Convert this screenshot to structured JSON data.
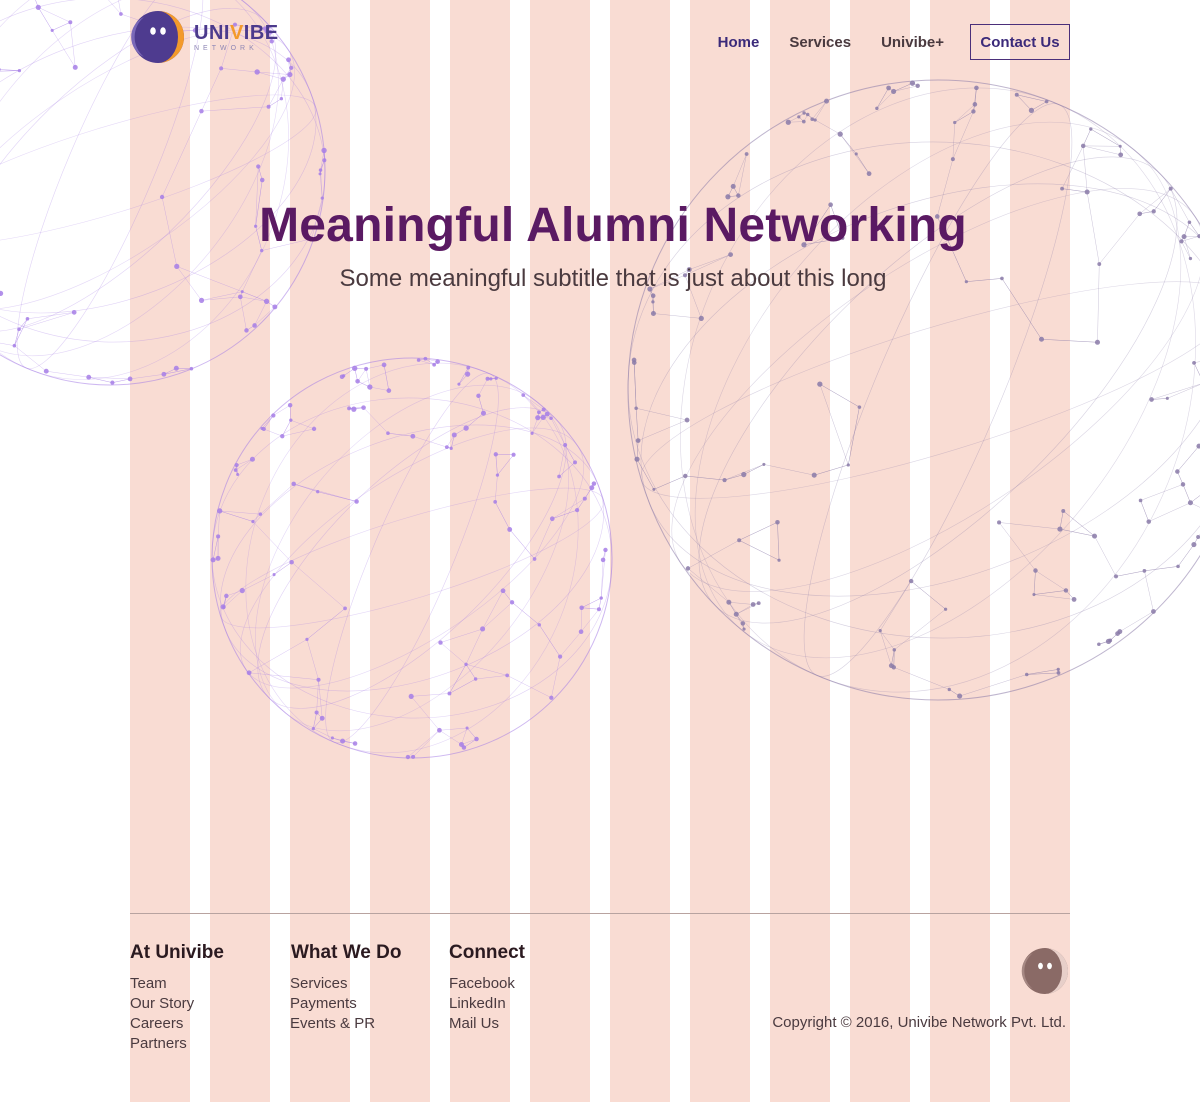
{
  "brand": {
    "name_part1": "UNI",
    "name_part2": "V",
    "name_part3": "IBE",
    "tagline": "NETWORK"
  },
  "nav": {
    "items": [
      "Home",
      "Services",
      "Univibe+"
    ],
    "contact_label": "Contact Us"
  },
  "hero": {
    "title": "Meaningful Alumni Networking",
    "subtitle": "Some meaningful subtitle that is just about this long"
  },
  "footer": {
    "columns": [
      {
        "heading": "At Univibe",
        "links": [
          "Team",
          "Our Story",
          "Careers",
          "Partners"
        ]
      },
      {
        "heading": "What We Do",
        "links": [
          "Services",
          "Payments",
          "Events & PR"
        ]
      },
      {
        "heading": "Connect",
        "links": [
          "Facebook",
          "LinkedIn",
          "Mail Us"
        ]
      }
    ],
    "copyright": "Copyright © 2016, Univibe Network Pvt. Ltd."
  },
  "colors": {
    "grid_column": "#f9dcd3",
    "brand_purple": "#4b3a8c",
    "brand_orange": "#f39a2b",
    "hero_title": "#5a1a63",
    "network_light": "#a67ee6",
    "network_dark": "#8a7aa8"
  },
  "icons": {
    "logo": "smiley-face-logo-icon",
    "footer_logo": "smiley-face-logo-icon"
  }
}
